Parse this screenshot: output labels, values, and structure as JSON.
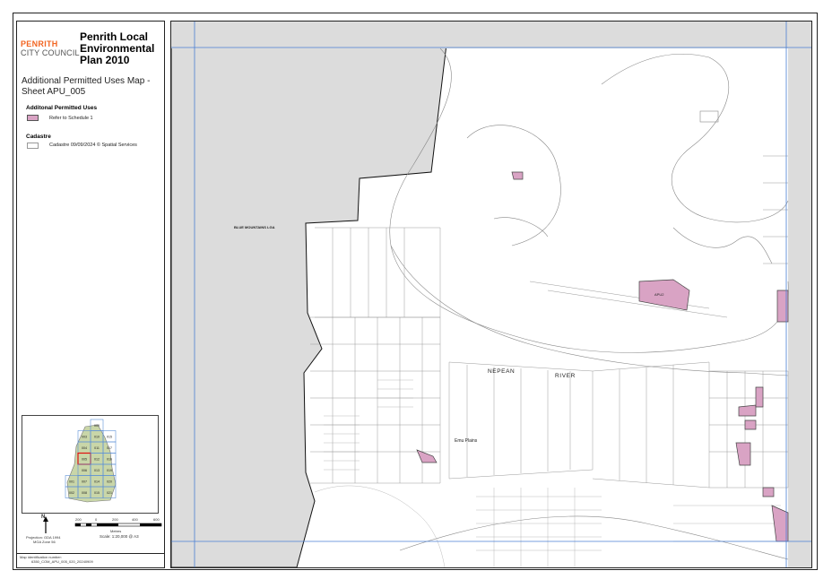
{
  "logo": {
    "line1": "PENRITH",
    "line2": "CITY COUNCIL",
    "accent_color": "#f26522"
  },
  "plan_title": "Penrith Local Environmental Plan 2010",
  "map_title": "Additional Permitted Uses Map - Sheet APU_005",
  "legend": {
    "apu_heading": "Additonal Permitted Uses",
    "apu_item": {
      "label": "Refer to Schedule 1",
      "color": "#d9a3c4"
    },
    "cadastre_heading": "Cadastre",
    "cadastre_item": {
      "label": "Cadastre 09/09/2024  ©  Spatial Services"
    }
  },
  "index_map": {
    "sheets": [
      "009",
      "003",
      "010",
      "015",
      "004",
      "011",
      "017",
      "005",
      "012",
      "016",
      "006",
      "013",
      "019",
      "001",
      "007",
      "014",
      "020",
      "002",
      "008",
      "015",
      "021"
    ],
    "current_sheet": "005"
  },
  "scale": {
    "north_label": "N",
    "ticks": [
      "200",
      "0",
      "200",
      "400",
      "600"
    ],
    "unit": "Metres",
    "scale_text": "Scale: 1:20,000 @ A3",
    "projection": "Projection: GDA 1994",
    "zone": "MGA Zone 56"
  },
  "map_id": {
    "label": "Map identification number:",
    "value": "6350_COM_APU_005_020_20240909"
  },
  "map_labels": {
    "lga": "BLUE MOUNTAINS LGA",
    "river_1": "NEPEAN",
    "river_2": "RIVER",
    "suburb": "Emu Plains",
    "apu_tag": "APU2"
  },
  "colors": {
    "apu_fill": "#d9a3c4",
    "outside_area": "#dcdcdc",
    "grid_line": "#4a7fd4"
  }
}
